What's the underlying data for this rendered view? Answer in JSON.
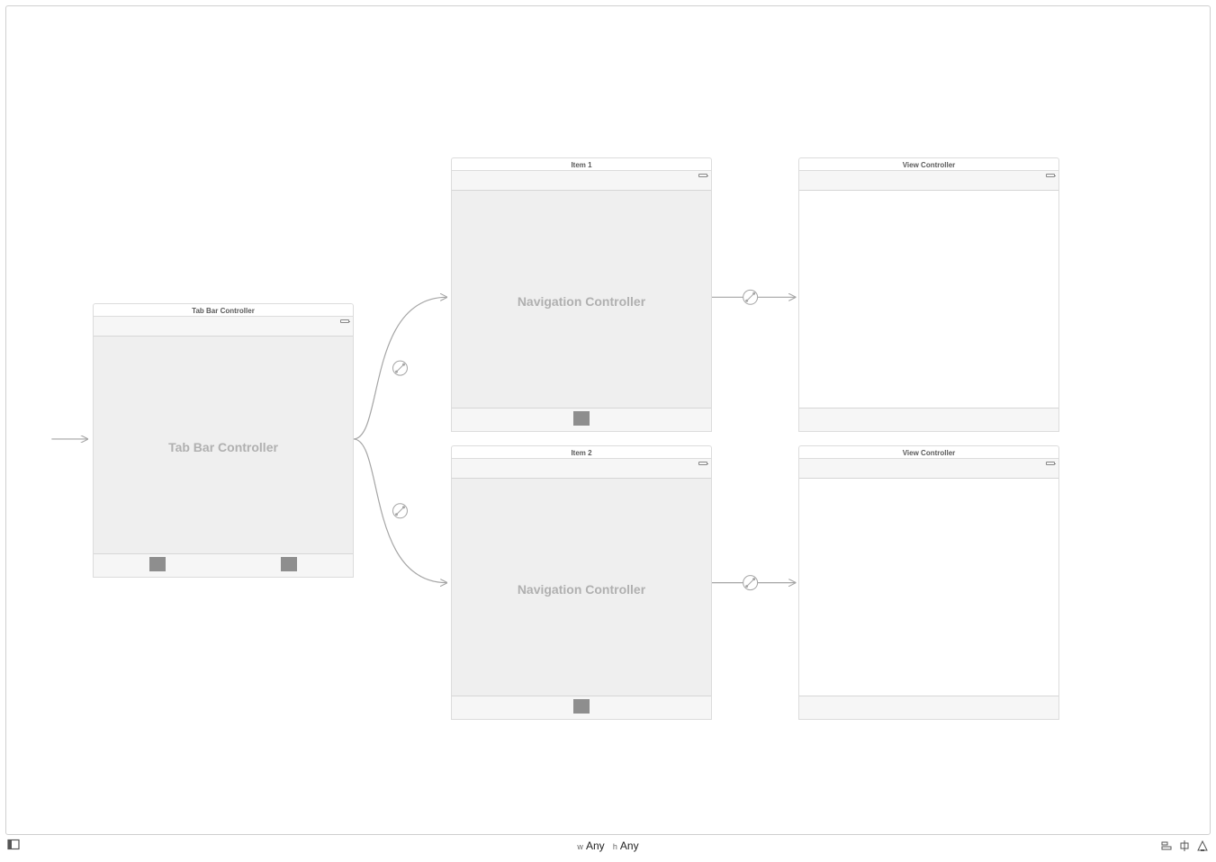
{
  "scenes": {
    "tabBar": {
      "title": "Tab Bar Controller",
      "bodyLabel": "Tab Bar Controller"
    },
    "nav1": {
      "title": "Item 1",
      "bodyLabel": "Navigation Controller"
    },
    "nav2": {
      "title": "Item 2",
      "bodyLabel": "Navigation Controller"
    },
    "vc1": {
      "title": "View Controller"
    },
    "vc2": {
      "title": "View Controller"
    }
  },
  "sizeClass": {
    "wPrefix": "w",
    "wValue": "Any",
    "hPrefix": "h",
    "hValue": "Any"
  }
}
